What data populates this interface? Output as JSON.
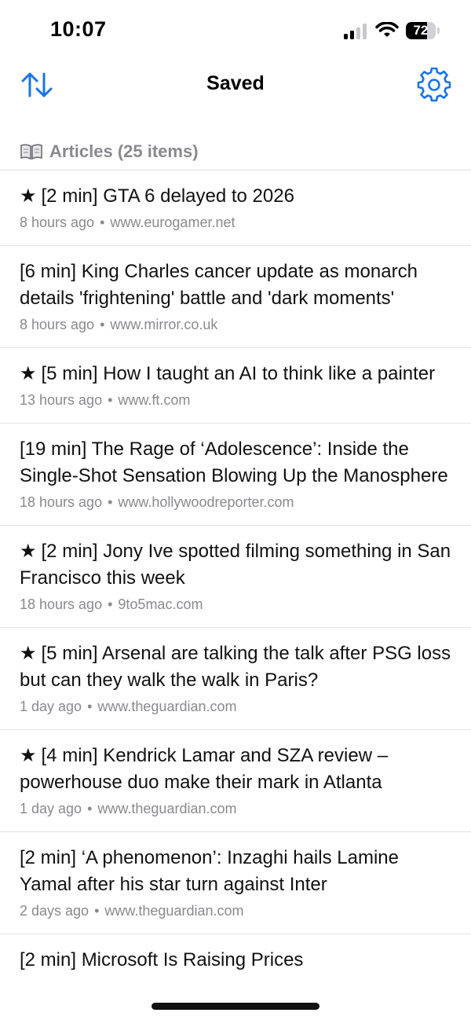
{
  "status_bar": {
    "time": "10:07",
    "battery_level": "72",
    "battery_fraction": 0.72
  },
  "nav": {
    "title": "Saved",
    "left_icon": "sort-arrows-icon",
    "right_icon": "gear-icon",
    "accent_color": "#1a73e8"
  },
  "section": {
    "icon": "book-icon",
    "title": "Articles (25 items)"
  },
  "articles": [
    {
      "starred": true,
      "star": "★",
      "title": "[2 min] GTA 6 delayed to 2026",
      "age": "8 hours ago",
      "sep": "•",
      "source": "www.eurogamer.net"
    },
    {
      "starred": false,
      "star": "",
      "title": "[6 min] King Charles cancer update as monarch details 'frightening' battle and 'dark moments'",
      "age": "8 hours ago",
      "sep": "•",
      "source": "www.mirror.co.uk"
    },
    {
      "starred": true,
      "star": "★",
      "title": "[5 min] How I taught an AI to think like a painter",
      "age": "13 hours ago",
      "sep": "•",
      "source": "www.ft.com"
    },
    {
      "starred": false,
      "star": "",
      "title": "[19 min] The Rage of ‘Adolescence’: Inside the Single-Shot Sensation Blowing Up the Manosphere",
      "age": "18 hours ago",
      "sep": "•",
      "source": "www.hollywoodreporter.com"
    },
    {
      "starred": true,
      "star": "★",
      "title": "[2 min] Jony Ive spotted filming something in San Francisco this week",
      "age": "18 hours ago",
      "sep": "•",
      "source": "9to5mac.com"
    },
    {
      "starred": true,
      "star": "★",
      "title": "[5 min] Arsenal are talking the talk after PSG loss but can they walk the walk in Paris?",
      "age": "1 day ago",
      "sep": "•",
      "source": "www.theguardian.com"
    },
    {
      "starred": true,
      "star": "★",
      "title": "[4 min] Kendrick Lamar and SZA review – powerhouse duo make their mark in Atlanta",
      "age": "1 day ago",
      "sep": "•",
      "source": "www.theguardian.com"
    },
    {
      "starred": false,
      "star": "",
      "title": "[2 min] ‘A phenomenon’: Inzaghi hails Lamine Yamal after his star turn against Inter",
      "age": "2 days ago",
      "sep": "•",
      "source": "www.theguardian.com"
    },
    {
      "starred": false,
      "star": "",
      "title": "[2 min] Microsoft Is Raising Prices",
      "age": "",
      "sep": "",
      "source": ""
    }
  ]
}
